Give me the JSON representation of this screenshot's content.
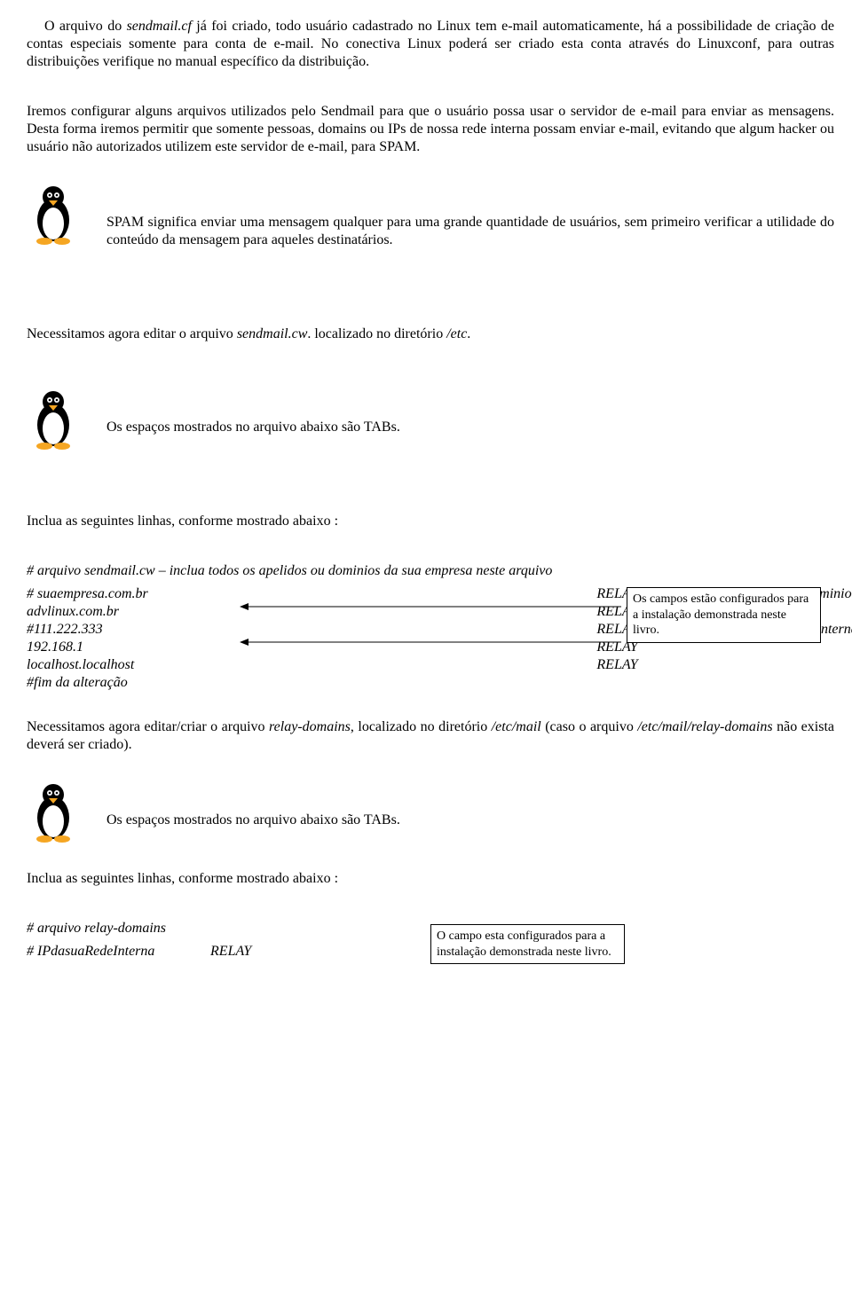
{
  "p1_part1": "O arquivo do ",
  "p1_italic": "sendmail.cf",
  "p1_part2": " já foi criado, todo usuário cadastrado no Linux tem e-mail automaticamente, há a possibilidade de criação de contas especiais somente para conta de e-mail. No conectiva Linux poderá ser criado esta conta através do Linuxconf, para outras distribuições verifique no manual específico da distribuição.",
  "p2": "Iremos configurar alguns arquivos utilizados pelo Sendmail para que o usuário possa usar o servidor de e-mail para enviar as mensagens. Desta forma iremos permitir que somente pessoas, domains ou IPs de nossa rede interna possam enviar e-mail, evitando que algum hacker ou usuário não autorizados utilizem este servidor de e-mail, para SPAM.",
  "caption1": "SPAM significa enviar uma mensagem qualquer para uma grande quantidade de usuários, sem primeiro verificar a utilidade do conteúdo da mensagem para aqueles destinatários.",
  "p3_a": "Necessitamos agora editar o arquivo ",
  "p3_b": "sendmail.cw",
  "p3_c": ". localizado no diretório ",
  "p3_d": "/etc",
  "p3_e": ".",
  "caption2": "Os espaços mostrados no arquivo abaixo são TABs.",
  "inc1": "Inclua as seguintes linhas, conforme mostrado abaixo :",
  "cfg1": {
    "r0c0": "# arquivo sendmail.cw – inclua todos os apelidos ou dominios da sua empresa neste arquivo",
    "r1c0": "# suaempresa.com.br",
    "r1c1": "RELAY ---> Coloque o NomeDoSeuDominio",
    "r2c0": "advlinux.com.br",
    "r2c1": "RELAY",
    "r3c0": "#111.222.333",
    "r3c1": "RELAY ---> Coloque o IP da sua rede interna",
    "r4c0": "192.168.1",
    "r4c1": "RELAY",
    "r5c0": "localhost.localhost",
    "r5c1": "RELAY",
    "r6c0": "#fim da alteração"
  },
  "note1": "Os campos estão configurados para a instalação demonstrada neste livro.",
  "p4_a": "Necessitamos agora editar/criar o arquivo ",
  "p4_b": "relay-domains",
  "p4_c": ", localizado no diretório ",
  "p4_d": "/etc/mail",
  "p4_e": " (caso o arquivo ",
  "p4_f": "/etc/mail/relay-domains",
  "p4_g": " não exista deverá ser criado).",
  "caption3": "Os espaços mostrados no arquivo abaixo são TABs.",
  "inc2": "Inclua as seguintes linhas, conforme mostrado abaixo :",
  "cfg2": {
    "r0c0": "# arquivo relay-domains",
    "r1c0": "# IPdasuaRedeInterna",
    "r1c1": "RELAY"
  },
  "note2": "O campo esta configurados para a instalação demonstrada neste livro."
}
